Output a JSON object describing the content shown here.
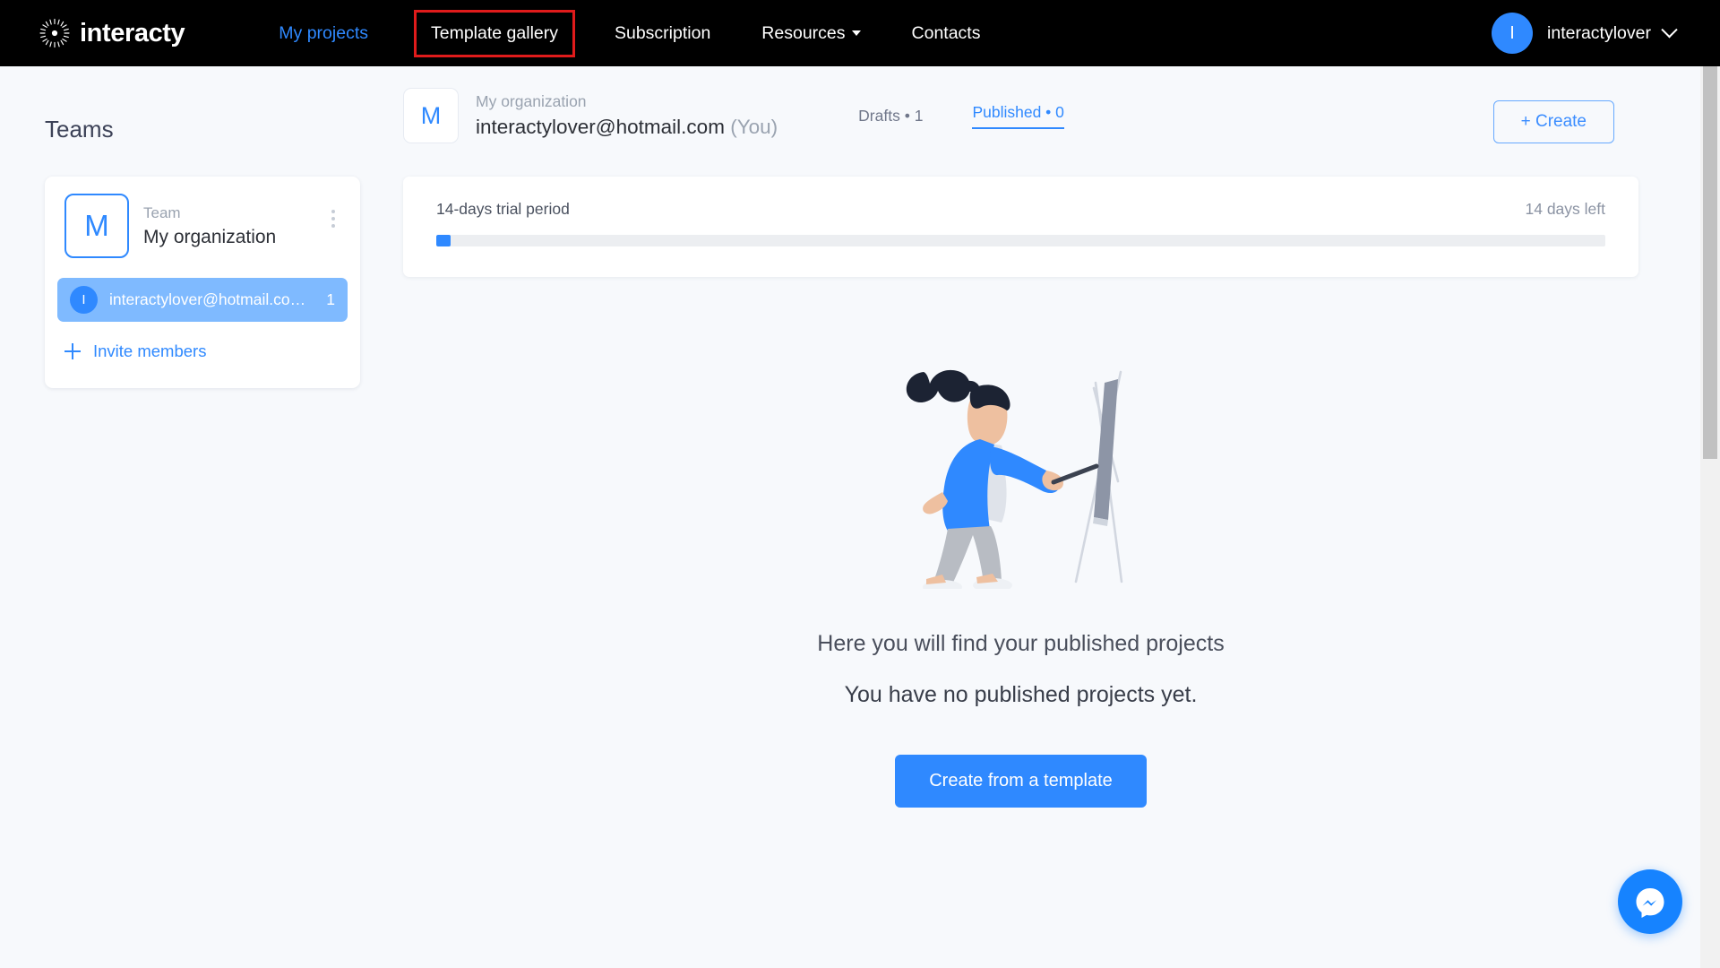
{
  "nav": {
    "brand": "interacty",
    "brand_icon": "radial-burst-logo",
    "links": [
      {
        "label": "My projects",
        "style": "blue"
      },
      {
        "label": "Template gallery",
        "style": "highlighted"
      },
      {
        "label": "Subscription",
        "style": "plain"
      },
      {
        "label": "Resources",
        "style": "dropdown"
      },
      {
        "label": "Contacts",
        "style": "plain"
      }
    ],
    "highlight_color": "#e01b1b",
    "accent_color": "#2f89ff",
    "background": "#000000",
    "user": {
      "avatar_initial": "I",
      "name": "interactylover",
      "chevron_icon": "chevron-down-icon"
    }
  },
  "sidebar": {
    "title": "Teams",
    "team": {
      "logo_initial": "M",
      "label": "Team",
      "name": "My organization",
      "menu_icon": "kebab-menu-icon"
    },
    "member": {
      "avatar_initial": "I",
      "email": "interactylover@hotmail.com…",
      "count": "1"
    },
    "invite": {
      "icon": "plus-icon",
      "label": "Invite members"
    }
  },
  "main": {
    "org": {
      "logo_initial": "M",
      "label": "My organization",
      "email": "interactylover@hotmail.com",
      "you_suffix": "(You)"
    },
    "filters": [
      {
        "label": "Drafts • 1",
        "active": false
      },
      {
        "label": "Published  • 0",
        "active": true
      }
    ],
    "create_button": "+ Create",
    "trial": {
      "label": "14-days trial period",
      "remaining": "14 days left",
      "progress_percent": 1.2
    },
    "empty_state": {
      "illustration": "woman-painting-at-easel-illustration",
      "line1": "Here you will find your published projects",
      "line2": "You have no published projects yet.",
      "button": "Create from a template"
    }
  },
  "widgets": {
    "messenger": {
      "icon": "facebook-messenger-icon",
      "color": "#1683ff"
    }
  },
  "scrollbar": {
    "thumb_top_percent": 0,
    "thumb_height_percent": 43.5
  }
}
